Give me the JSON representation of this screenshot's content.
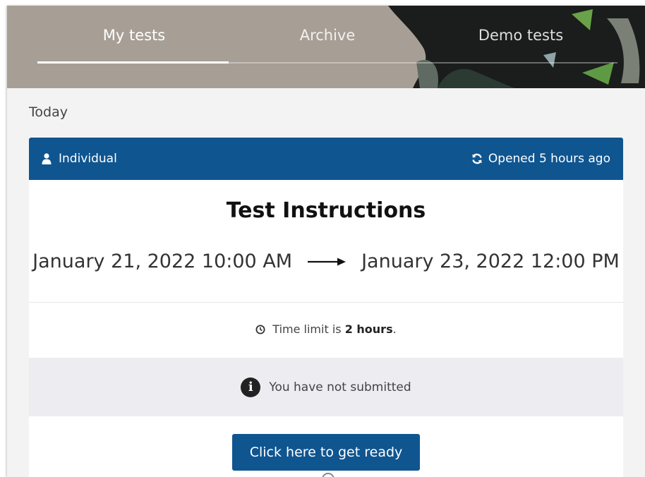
{
  "tabs": [
    {
      "label": "My tests",
      "active": true
    },
    {
      "label": "Archive",
      "active": false
    },
    {
      "label": "Demo tests",
      "active": false
    }
  ],
  "section": {
    "title": "Today"
  },
  "card": {
    "type_icon": "user-icon",
    "type_label": "Individual",
    "status_icon": "refresh-icon",
    "status_label": "Opened 5 hours ago",
    "title": "Test Instructions",
    "start": "January 21, 2022 10:00 AM",
    "arrow_icon": "arrow-right-icon",
    "end": "January 23, 2022 12:00 PM",
    "time_limit_icon": "clock-icon",
    "time_limit_prefix": "Time limit is",
    "time_limit_value": "2 hours",
    "time_limit_suffix": ".",
    "submission_icon": "info-icon",
    "submission_status": "You have not submitted",
    "action_button": "Click here to get ready"
  },
  "colors": {
    "primary": "#0f5590",
    "band": "#ececf1",
    "page_bg": "#f3f3f3"
  }
}
